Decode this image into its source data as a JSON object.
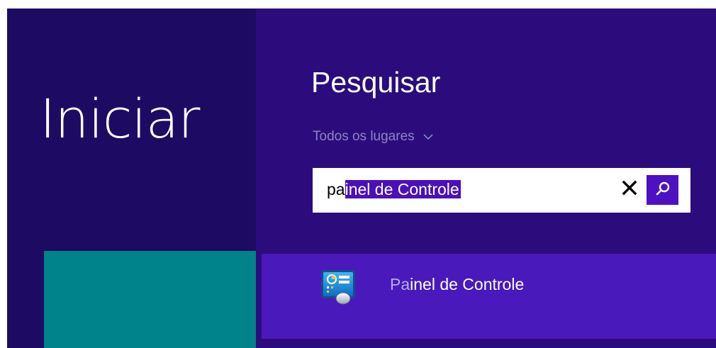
{
  "start": {
    "title": "Iniciar"
  },
  "search": {
    "title": "Pesquisar",
    "scope": "Todos os lugares",
    "query_prefix": "pa",
    "query_selected": "inel de Controle",
    "clear_icon": "close-icon",
    "search_icon": "search-icon"
  },
  "results": [
    {
      "match": "Pa",
      "rest": "inel de Controle",
      "icon": "control-panel-icon"
    }
  ],
  "colors": {
    "start_bg": "#1d0b63",
    "search_bg": "#2c0c7c",
    "result_bg": "#4a19bb",
    "selection": "#4b10ba",
    "search_button": "#4e10c3",
    "tile": "#00838a"
  }
}
